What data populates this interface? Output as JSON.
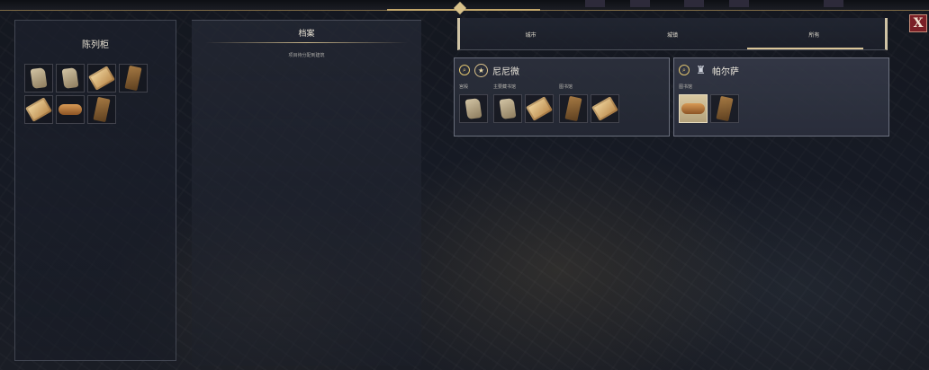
{
  "window": {
    "close_label": "X"
  },
  "left_panel": {
    "title": "陈列柜",
    "rows": [
      [
        {
          "icon": "tablet"
        },
        {
          "icon": "tablet"
        },
        {
          "icon": "scroll"
        },
        {
          "icon": "book"
        }
      ],
      [
        {
          "icon": "scroll"
        },
        {
          "icon": "roll"
        },
        {
          "icon": "book"
        }
      ]
    ]
  },
  "archive_panel": {
    "title": "档案",
    "subtitle": "项目待分配到建筑"
  },
  "tabs": [
    {
      "label": "城市",
      "active": false
    },
    {
      "label": "城镇",
      "active": false
    },
    {
      "label": "所有",
      "active": true
    }
  ],
  "cities": [
    {
      "name": "尼尼微",
      "emblem": "star-emblem",
      "groups": [
        {
          "label": "宫殿",
          "items": [
            "tablet"
          ]
        },
        {
          "label": "主要藏书馆",
          "items": [
            "tablet",
            "scroll"
          ]
        },
        {
          "label": "图书馆",
          "items": [
            "book",
            "scroll"
          ]
        }
      ]
    },
    {
      "name": "帕尔萨",
      "emblem": "castle-emblem",
      "groups": [
        {
          "label": "图书馆",
          "items": [
            "roll",
            "book"
          ]
        }
      ]
    }
  ],
  "colors": {
    "accent_gold": "#c9b589",
    "close_red": "#7a1f26"
  }
}
